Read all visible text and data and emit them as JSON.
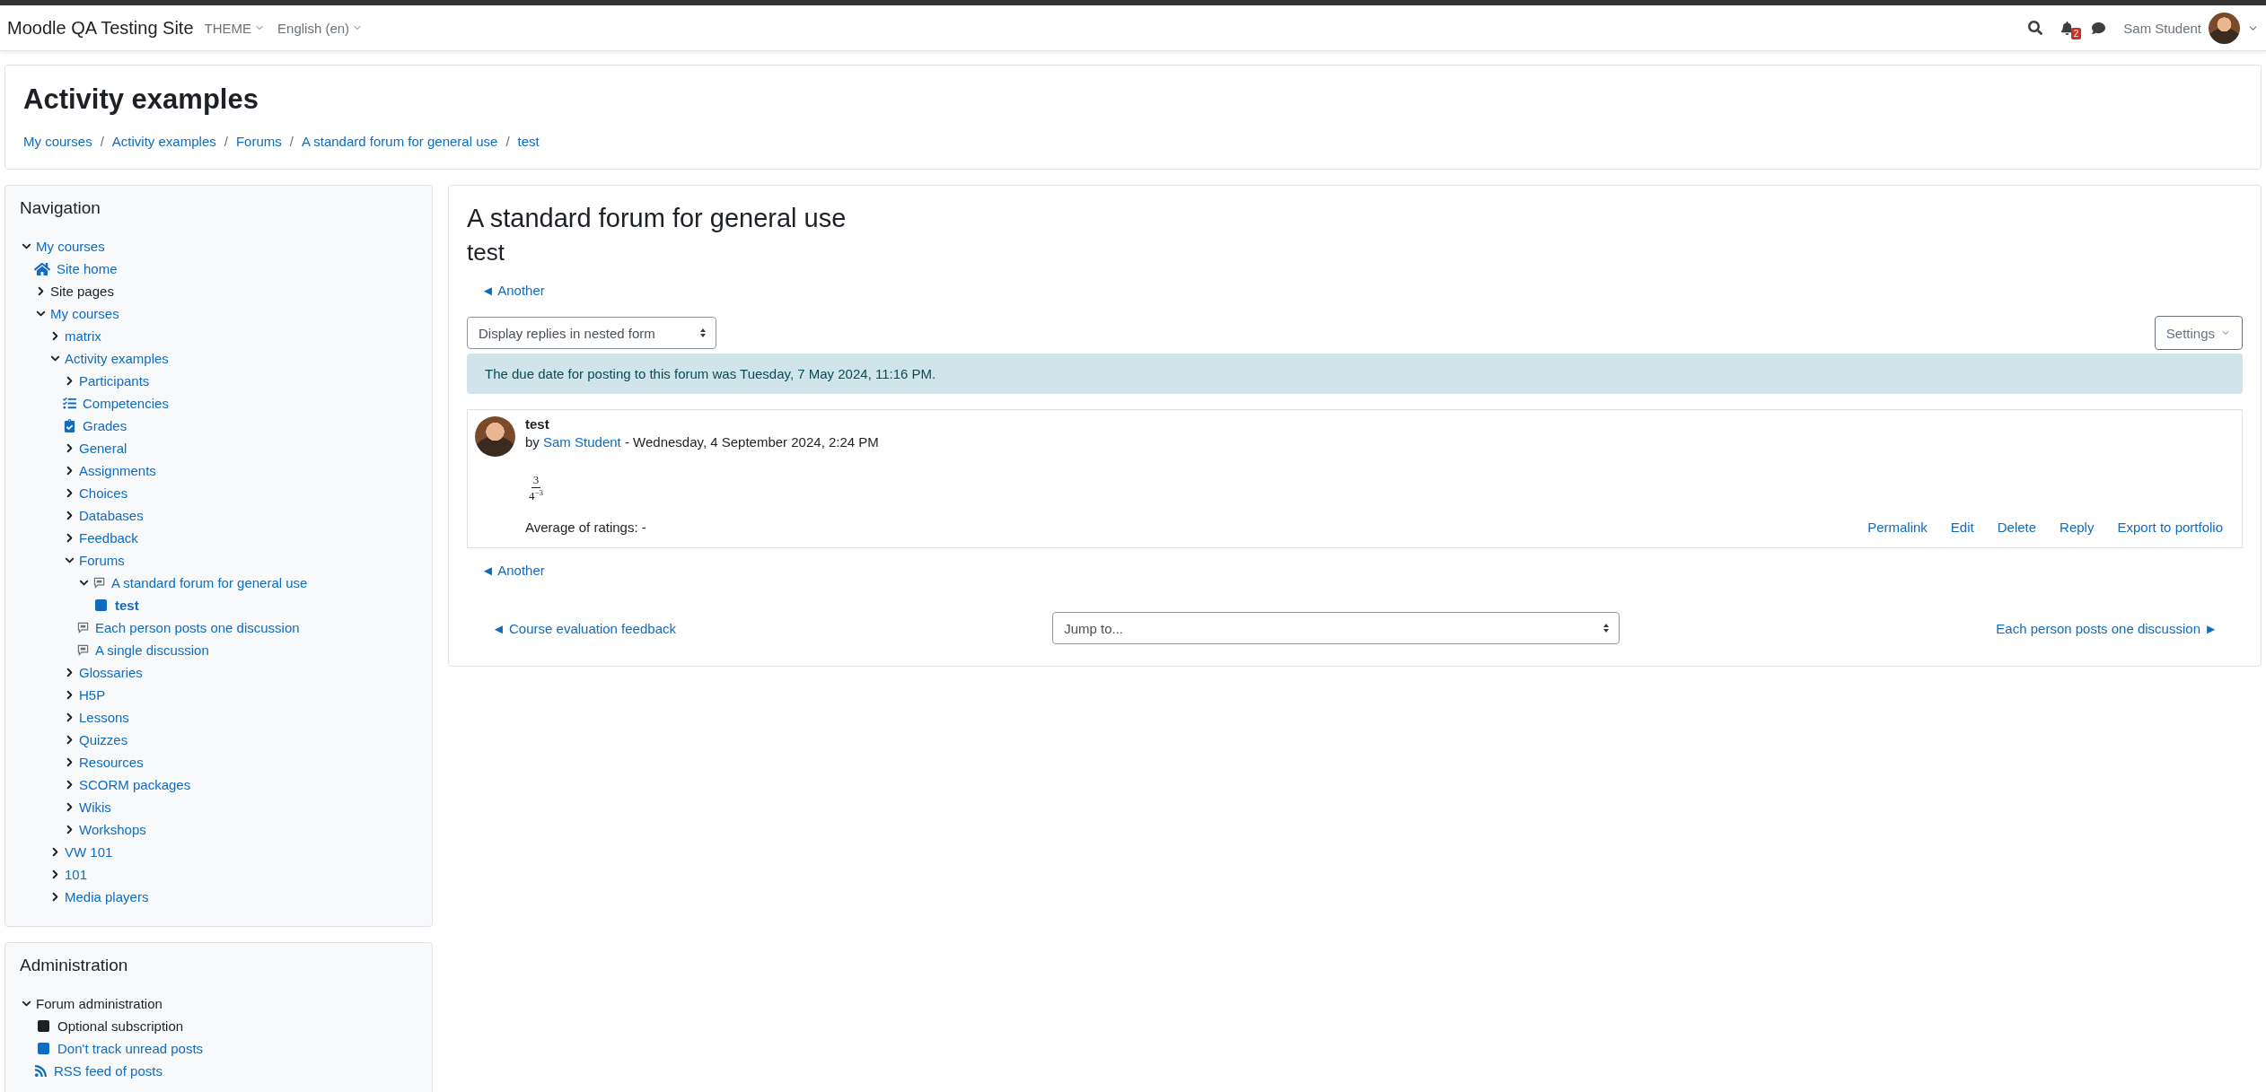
{
  "navbar": {
    "site_name": "Moodle QA Testing Site",
    "menus": [
      {
        "label": "THEME"
      },
      {
        "label": "English (en)"
      }
    ],
    "notification_count": "2",
    "user_name": "Sam Student"
  },
  "page_header": {
    "title": "Activity examples",
    "breadcrumbs": [
      {
        "label": "My courses"
      },
      {
        "separator": "/",
        "label": "Activity examples"
      },
      {
        "separator": "/",
        "label": "Forums"
      },
      {
        "separator": "/",
        "label": "A standard forum for general use"
      },
      {
        "separator": "/",
        "label": "test"
      }
    ]
  },
  "navigation": {
    "title": "Navigation",
    "items": [
      {
        "label": "My courses",
        "link": true,
        "expanded": true,
        "current": false,
        "children": [
          {
            "label": "Site home",
            "kind": "home",
            "link": true,
            "current": false
          },
          {
            "label": "Site pages",
            "link": false,
            "expanded": false,
            "current": false
          },
          {
            "label": "My courses",
            "link": true,
            "expanded": true,
            "current": false,
            "children": [
              {
                "label": "matrix",
                "link": true,
                "expanded": false,
                "current": false
              },
              {
                "label": "Activity examples",
                "link": true,
                "expanded": true,
                "current": false,
                "children": [
                  {
                    "label": "Participants",
                    "link": true,
                    "expanded": false,
                    "current": false
                  },
                  {
                    "label": "Competencies",
                    "kind": "checklist",
                    "link": true,
                    "current": false
                  },
                  {
                    "label": "Grades",
                    "kind": "clipboard",
                    "link": true,
                    "current": false
                  },
                  {
                    "label": "General",
                    "link": true,
                    "expanded": false,
                    "current": false
                  },
                  {
                    "label": "Assignments",
                    "link": true,
                    "expanded": false,
                    "current": false
                  },
                  {
                    "label": "Choices",
                    "link": true,
                    "expanded": false,
                    "current": false
                  },
                  {
                    "label": "Databases",
                    "link": true,
                    "expanded": false,
                    "current": false
                  },
                  {
                    "label": "Feedback",
                    "link": true,
                    "expanded": false,
                    "current": false
                  },
                  {
                    "label": "Forums",
                    "link": true,
                    "expanded": true,
                    "current": false,
                    "children": [
                      {
                        "label": "A standard forum for general use",
                        "kind": "forum",
                        "link": true,
                        "expanded": true,
                        "current": false,
                        "children": [
                          {
                            "label": "test",
                            "kind": "square",
                            "link": true,
                            "current": true
                          }
                        ]
                      },
                      {
                        "label": "Each person posts one discussion",
                        "kind": "forum",
                        "link": true,
                        "current": false
                      },
                      {
                        "label": "A single discussion",
                        "kind": "forum",
                        "link": true,
                        "current": false
                      }
                    ]
                  },
                  {
                    "label": "Glossaries",
                    "link": true,
                    "expanded": false,
                    "current": false
                  },
                  {
                    "label": "H5P",
                    "link": true,
                    "expanded": false,
                    "current": false
                  },
                  {
                    "label": "Lessons",
                    "link": true,
                    "expanded": false,
                    "current": false
                  },
                  {
                    "label": "Quizzes",
                    "link": true,
                    "expanded": false,
                    "current": false
                  },
                  {
                    "label": "Resources",
                    "link": true,
                    "expanded": false,
                    "current": false
                  },
                  {
                    "label": "SCORM packages",
                    "link": true,
                    "expanded": false,
                    "current": false
                  },
                  {
                    "label": "Wikis",
                    "link": true,
                    "expanded": false,
                    "current": false
                  },
                  {
                    "label": "Workshops",
                    "link": true,
                    "expanded": false,
                    "current": false
                  }
                ]
              },
              {
                "label": "VW 101",
                "link": true,
                "expanded": false,
                "current": false
              },
              {
                "label": "101",
                "link": true,
                "expanded": false,
                "current": false
              },
              {
                "label": "Media players",
                "link": true,
                "expanded": false,
                "current": false
              }
            ]
          }
        ]
      }
    ]
  },
  "administration": {
    "title": "Administration",
    "items": [
      {
        "label": "Forum administration",
        "link": false,
        "expanded": true,
        "current": false,
        "children": [
          {
            "label": "Optional subscription",
            "kind": "square",
            "link": false,
            "current": false
          },
          {
            "label": "Don't track unread posts",
            "kind": "square",
            "link": true,
            "current": false
          },
          {
            "label": "RSS feed of posts",
            "kind": "rss",
            "link": true,
            "current": false
          }
        ]
      }
    ]
  },
  "main": {
    "forum_title": "A standard forum for general use",
    "discussion_title": "test",
    "prev_discussion": "◄ Another",
    "display_mode": "Display replies in nested form",
    "settings_button": "Settings",
    "notice": "The due date for posting to this forum was Tuesday, 7 May 2024, 11:16 PM.",
    "post": {
      "subject": "test",
      "by": "by",
      "author": "Sam Student",
      "date": "- Wednesday, 4 September 2024, 2:24 PM",
      "numerator": "3",
      "denominator": "4$^{−3}$",
      "ratings": "Average of ratings: -",
      "actions": [
        "Permalink",
        "Edit",
        "Delete",
        "Reply",
        "Export to portfolio"
      ]
    },
    "prev_discussion_bottom": "◄ Another",
    "activity_nav": {
      "prev": "◄ Course evaluation feedback",
      "jump": "Jump to...",
      "next": "Each person posts one discussion ►"
    }
  }
}
